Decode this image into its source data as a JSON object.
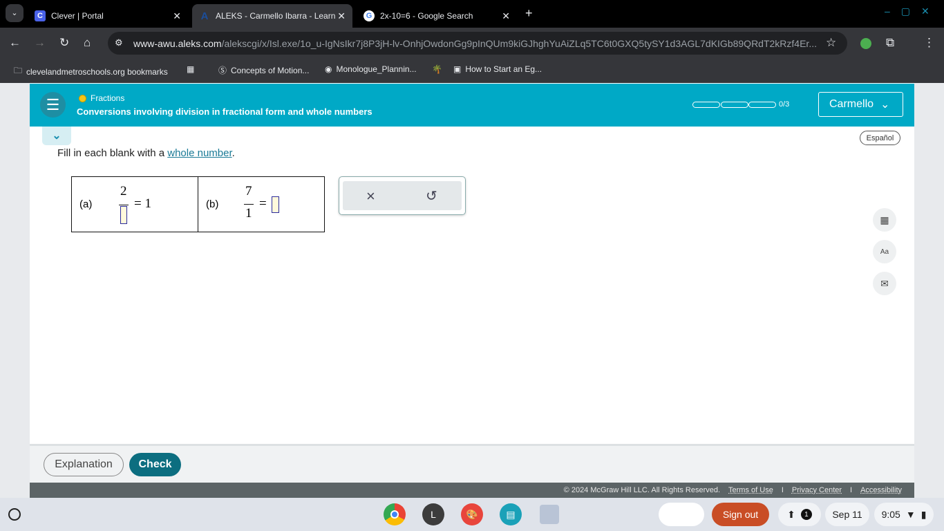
{
  "browser": {
    "tabs": [
      {
        "title": "Clever | Portal",
        "icon": "clever-icon"
      },
      {
        "title": "ALEKS - Carmello Ibarra - Learn",
        "icon": "aleks-icon",
        "active": true
      },
      {
        "title": "2x-10=6 - Google Search",
        "icon": "google-icon"
      }
    ],
    "url_host": "www-awu.aleks.com",
    "url_path": "/alekscgi/x/Isl.exe/1o_u-IgNsIkr7j8P3jH-lv-OnhjOwdonGg9pInQUm9kiGJhghYuAiZLq5TC6t0GXQ5tySY1d3AGL7dKIGb89QRdT2kRzf4Er...",
    "bookmarks": [
      "clevelandmetroschools.org bookmarks",
      "Concepts of Motion...",
      "Monologue_Plannin...",
      "How to Start an Eg..."
    ]
  },
  "header": {
    "topic": "Fractions",
    "title": "Conversions involving division in fractional form and whole numbers",
    "progress": "0/3",
    "progress_fraction": 0,
    "user": "Carmello"
  },
  "espanol": "Español",
  "instruction": {
    "prefix": "Fill in each blank with a ",
    "link": "whole number",
    "suffix": "."
  },
  "problems": [
    {
      "label": "(a)",
      "numerator": "2",
      "denominator": "",
      "rhs": "= 1"
    },
    {
      "label": "(b)",
      "numerator": "7",
      "denominator": "1",
      "rhs": "="
    }
  ],
  "keypad": {
    "clear": "×",
    "undo": "↺"
  },
  "buttons": {
    "explanation": "Explanation",
    "check": "Check"
  },
  "footer": {
    "copyright": "© 2024 McGraw Hill LLC. All Rights Reserved.",
    "terms": "Terms of Use",
    "privacy": "Privacy Center",
    "accessibility": "Accessibility",
    "sep": "I"
  },
  "shelf": {
    "launcher_letter": "L",
    "signout": "Sign out",
    "notifications": "1",
    "date": "Sep 11",
    "time": "9:05"
  }
}
